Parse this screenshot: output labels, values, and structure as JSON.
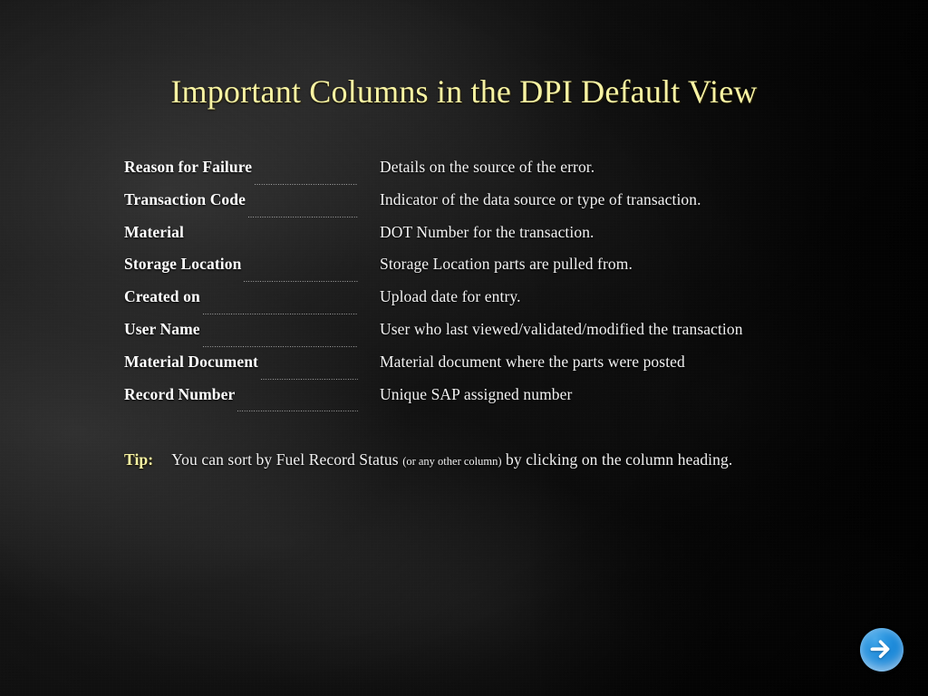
{
  "slide": {
    "title": "Important Columns in the DPI Default View",
    "title_color": "#F7F3A3",
    "background_color": "#0C0C0C",
    "body_text_color": "#F2F2F2",
    "accent_color": "#F7F3A3"
  },
  "columns": [
    {
      "label": "Reason for Failure",
      "description": "Details on the source of the error.",
      "leader": true
    },
    {
      "label": "Transaction Code",
      "description": "Indicator of the data source or type of transaction.",
      "leader": true
    },
    {
      "label": "Material",
      "description": "DOT Number for the transaction.",
      "leader": false
    },
    {
      "label": "Storage Location",
      "description": "Storage Location parts are pulled from.",
      "leader": true
    },
    {
      "label": "Created on",
      "description": "Upload date for entry.",
      "leader": true
    },
    {
      "label": "User Name",
      "description": "User who last viewed/validated/modified the transaction",
      "leader": true
    },
    {
      "label": "Material Document",
      "description": "Material document where the parts were posted",
      "leader": true
    },
    {
      "label": "Record Number",
      "description": "Unique SAP assigned number",
      "leader": true
    }
  ],
  "tip": {
    "label": "Tip:",
    "text_before": "You can sort by Fuel Record Status",
    "parenthetical": "(or any other column)",
    "text_after": "by clicking on the column heading."
  },
  "navigation": {
    "next_button": {
      "icon": "arrow-right-icon",
      "color": "#1383D6"
    }
  }
}
